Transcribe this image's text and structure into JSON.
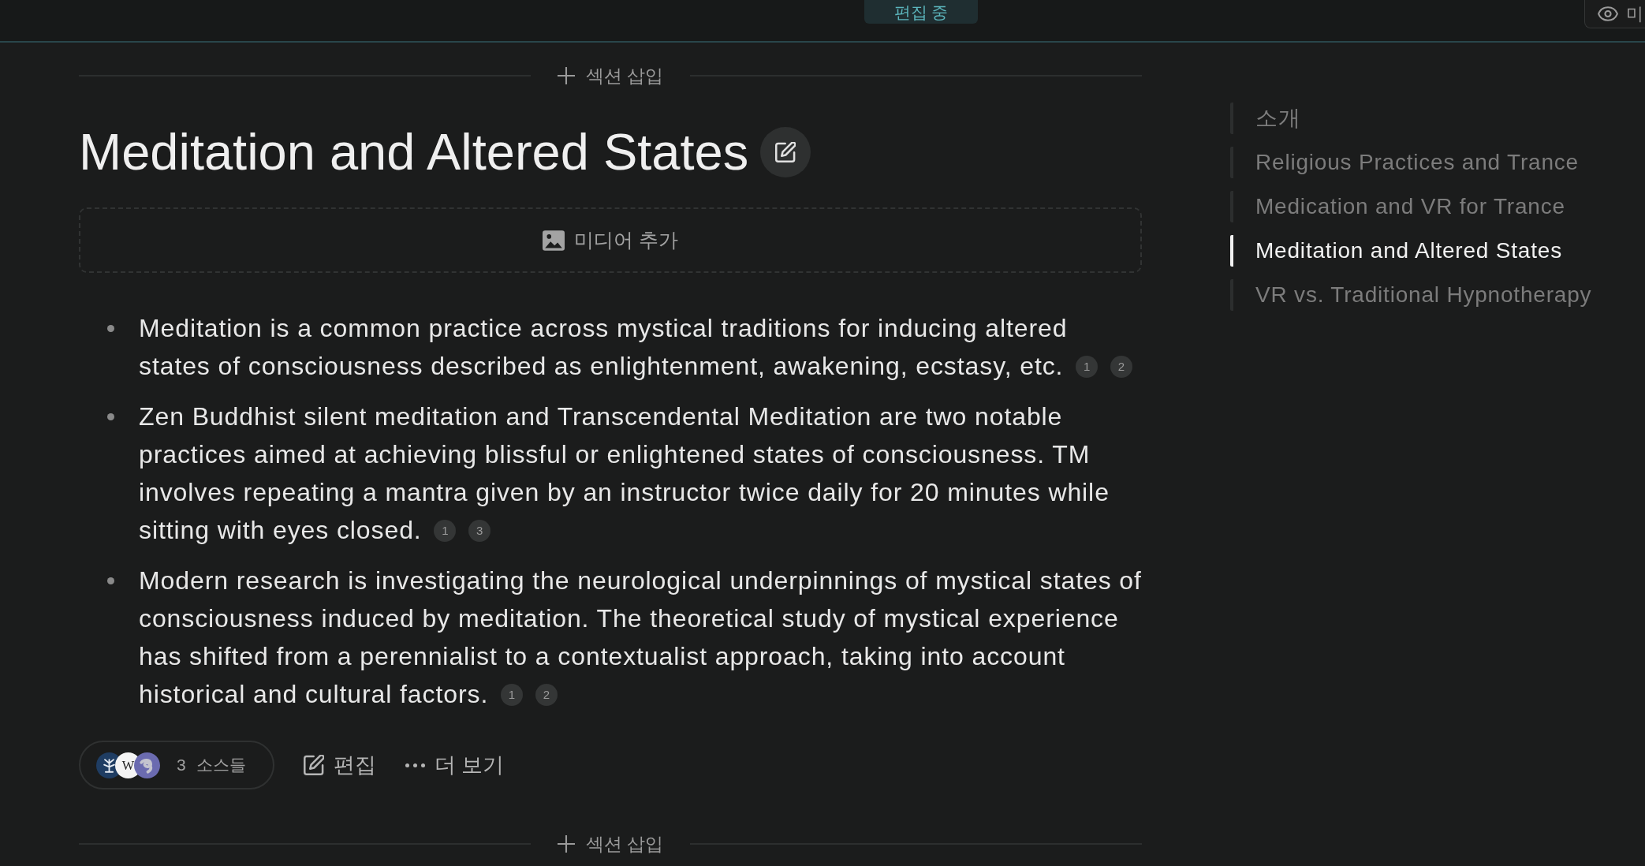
{
  "top_bar": {
    "status": "편집 중",
    "view_button": "미"
  },
  "insert_top": {
    "label": "섹션 삽입"
  },
  "section": {
    "title": "Meditation and Altered States",
    "add_media": {
      "label": "미디어 추가"
    },
    "bullets": [
      {
        "text": "Meditation is a common practice across mystical traditions for inducing altered states of consciousness described as enlightenment, awakening, ecstasy, etc.",
        "citations": [
          "1",
          "2"
        ]
      },
      {
        "text": "Zen Buddhist silent meditation and Transcendental Meditation are two notable practices aimed at achieving blissful or enlightened states of consciousness. TM involves repeating a mantra given by an instructor twice daily for 20 minutes while sitting with eyes closed.",
        "citations": [
          "1",
          "3"
        ]
      },
      {
        "text": "Modern research is investigating the neurological underpinnings of mystical states of consciousness induced by meditation. The theoretical study of mystical experience has shifted from a perennialist to a contextualist approach, taking into account historical and cultural factors.",
        "citations": [
          "1",
          "2"
        ]
      }
    ],
    "sources": {
      "count": "3",
      "label": "소스들",
      "icons": [
        {
          "kind": "emblem"
        },
        {
          "kind": "letter",
          "letter": "W"
        },
        {
          "kind": "swirl"
        }
      ]
    },
    "actions": [
      {
        "kind": "edit",
        "label": "편집"
      },
      {
        "kind": "more",
        "label": "더 보기"
      }
    ]
  },
  "insert_bottom": {
    "label": "섹션 삽입"
  },
  "toc": [
    {
      "label": "소개",
      "selected": false
    },
    {
      "label": "Religious Practices and Trance",
      "selected": false
    },
    {
      "label": "Medication and VR for Trance",
      "selected": false
    },
    {
      "label": "Meditation and Altered States",
      "selected": true
    },
    {
      "label": "VR vs. Traditional Hypnotherapy",
      "selected": false
    }
  ]
}
